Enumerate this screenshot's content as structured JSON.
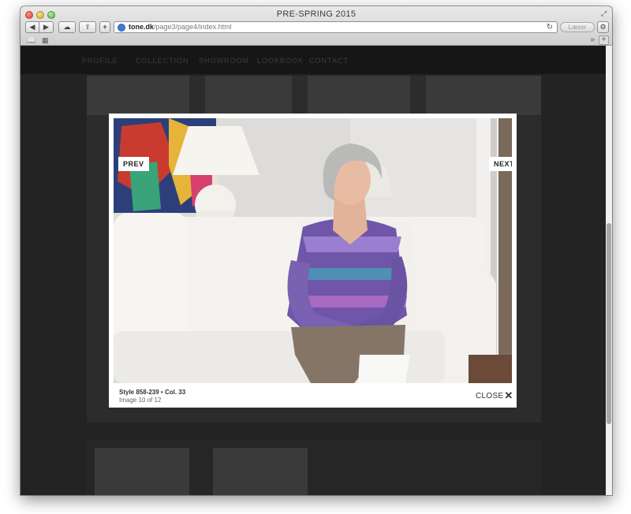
{
  "window": {
    "title": "PRE-SPRING 2015"
  },
  "toolbar": {
    "back": "◀",
    "forward": "▶",
    "add": "+",
    "url_host": "tone.dk",
    "url_path": "/page3/page4/index.html",
    "reader_label": "Læser",
    "more": "»"
  },
  "site": {
    "nav": [
      "Profile",
      "Collection",
      "Showroom",
      "Lookbook",
      "Contact"
    ]
  },
  "lightbox": {
    "prev_label": "PREV",
    "next_label": "NEXT",
    "caption_style": "Style 858-239 • Col. 33",
    "caption_count": "Image 10 of 12",
    "close_label": "CLOSE",
    "close_glyph": "✕"
  },
  "icons": {
    "icloud": "cloud-icon",
    "share": "share-icon",
    "reload": "reload-icon",
    "bookmarks": "book-icon",
    "top_sites": "grid-icon",
    "settings": "gear-icon"
  },
  "colors": {
    "page_bg": "#232323",
    "lightbox_bg": "#ffffff",
    "accent_url": "#3d7bd6"
  }
}
